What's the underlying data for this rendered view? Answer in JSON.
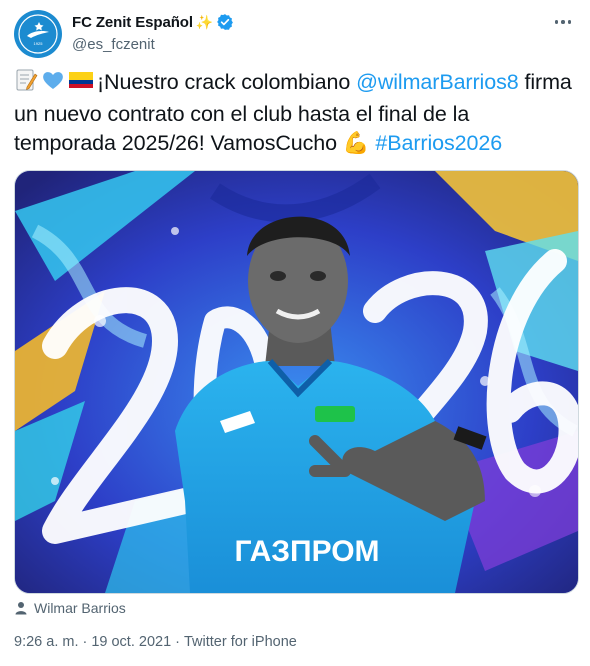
{
  "account": {
    "display_name": "FC Zenit Español",
    "sparkle": "✨",
    "handle": "@es_fczenit",
    "verified": true,
    "avatar_icon": "zenit-logo-icon",
    "avatar_color": "#1c8bd0"
  },
  "tweet": {
    "emojis": [
      "memo-emoji",
      "blue-heart-emoji",
      "colombia-flag-emoji"
    ],
    "text_1": "¡Nuestro crack colombiano ",
    "mention": "@wilmarBarrios8",
    "text_2": " firma un nuevo contrato con el club hasta el final de la temporada 2025/26! VamosCucho ",
    "flex_emoji": "💪",
    "hashtag": "#Barrios2026",
    "link_color": "#1d9bf0"
  },
  "media": {
    "alt": "Wilmar Barrios 2026",
    "big_number": "2026",
    "sponsor": "ГАЗПРОМ"
  },
  "tagged_user": "Wilmar Barrios",
  "meta": {
    "time": "9:26 a. m.",
    "separator": "·",
    "date": "19 oct. 2021",
    "source": "Twitter for iPhone"
  }
}
